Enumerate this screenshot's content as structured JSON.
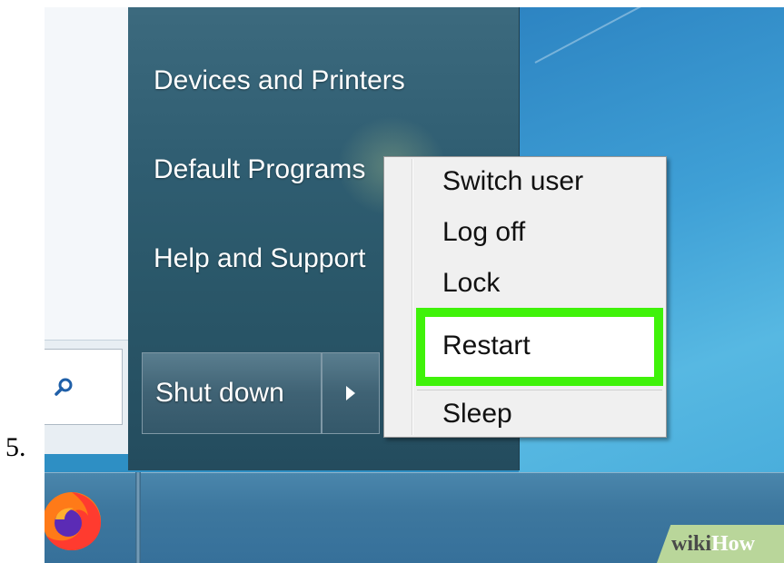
{
  "step_number": "5.",
  "start_menu": {
    "links": [
      {
        "label": "Devices and Printers"
      },
      {
        "label": "Default Programs"
      },
      {
        "label": "Help and Support"
      }
    ],
    "shutdown_label": "Shut down",
    "search_icon": "search-icon",
    "arrow_icon": "chevron-right-icon"
  },
  "power_menu": {
    "items": [
      {
        "label": "Switch user"
      },
      {
        "label": "Log off"
      },
      {
        "label": "Lock"
      },
      {
        "label": "Restart",
        "highlighted": true
      },
      {
        "label": "Sleep"
      }
    ],
    "highlight_color": "#3ff20a"
  },
  "taskbar": {
    "pinned_icon": "firefox-icon"
  },
  "watermark": {
    "part1": "wiki",
    "part2": "How"
  }
}
